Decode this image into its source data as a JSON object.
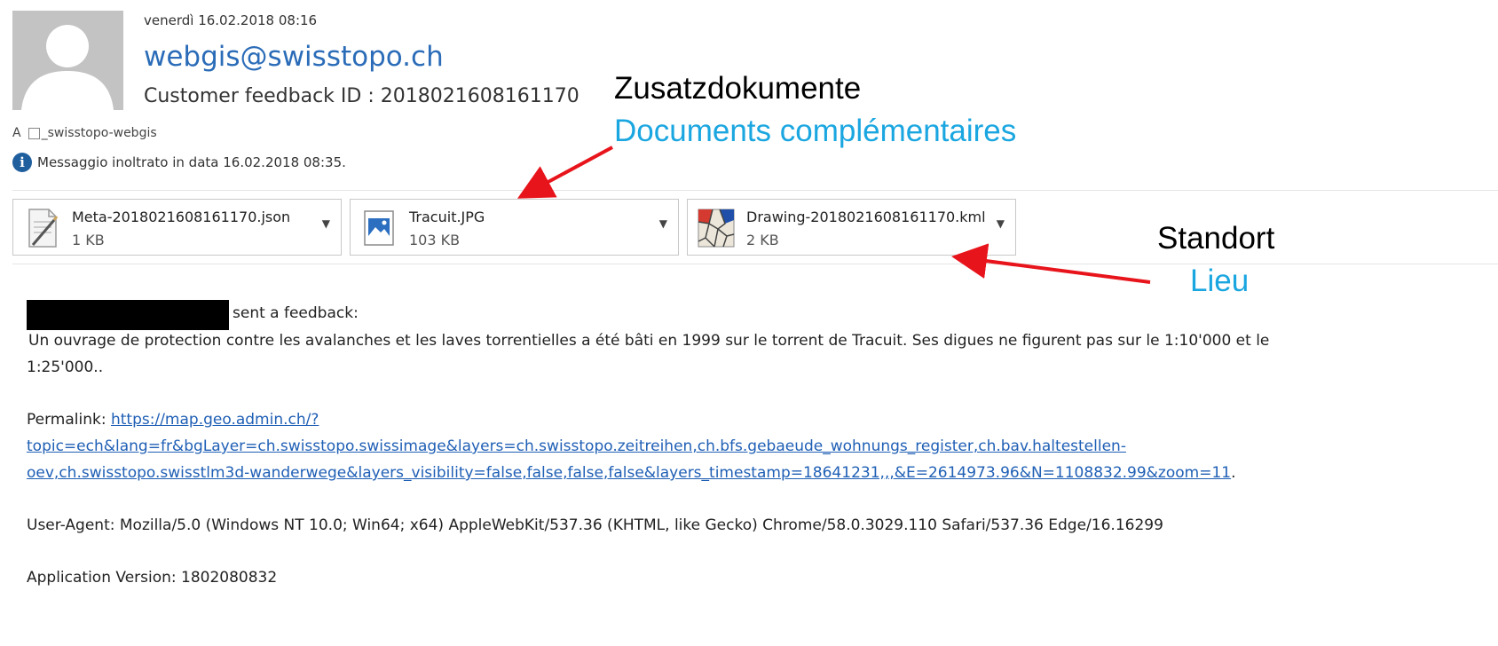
{
  "header": {
    "date": "venerdì 16.02.2018 08:16",
    "sender": "webgis@swisstopo.ch",
    "subject": "Customer feedback ID : 2018021608161170",
    "to_prefix": "A",
    "to_recipient": "_swisstopo-webgis",
    "info_text": "Messaggio inoltrato in data 16.02.2018 08:35."
  },
  "attachments": [
    {
      "name": "Meta-2018021608161170.json",
      "size": "1 KB",
      "icon": "json-file-icon"
    },
    {
      "name": "Tracuit.JPG",
      "size": "103 KB",
      "icon": "image-file-icon"
    },
    {
      "name": "Drawing-2018021608161170.kml",
      "size": "2 KB",
      "icon": "kml-file-icon"
    }
  ],
  "annotations": {
    "docs_de": "Zusatzdokumente",
    "docs_fr": "Documents complémentaires",
    "place_de": "Standort",
    "place_fr": "Lieu",
    "colors": {
      "black": "#000000",
      "cyan": "#1aa6e0",
      "arrow": "#e8141b"
    }
  },
  "body": {
    "feedback_label": "sent a feedback:",
    "message_line1": "Un ouvrage de protection contre les avalanches et les laves torrentielles a été bâti en 1999 sur le torrent de Tracuit. Ses digues ne figurent pas sur le 1:10'000 et le",
    "message_line2": "1:25'000..",
    "permalink_label": "Permalink:",
    "permalink_line1": "https://map.geo.admin.ch/?",
    "permalink_line2": "topic=ech&lang=fr&bgLayer=ch.swisstopo.swissimage&layers=ch.swisstopo.zeitreihen,ch.bfs.gebaeude_wohnungs_register,ch.bav.haltestellen-",
    "permalink_line3": "oev,ch.swisstopo.swisstlm3d-wanderwege&layers_visibility=false,false,false,false&layers_timestamp=18641231,,,&E=2614973.96&N=1108832.99&zoom=11",
    "permalink_trailing": ".",
    "user_agent": "User-Agent: Mozilla/5.0 (Windows NT 10.0; Win64; x64) AppleWebKit/537.36 (KHTML, like Gecko) Chrome/58.0.3029.110 Safari/537.36 Edge/16.16299",
    "app_version": "Application Version: 1802080832"
  }
}
